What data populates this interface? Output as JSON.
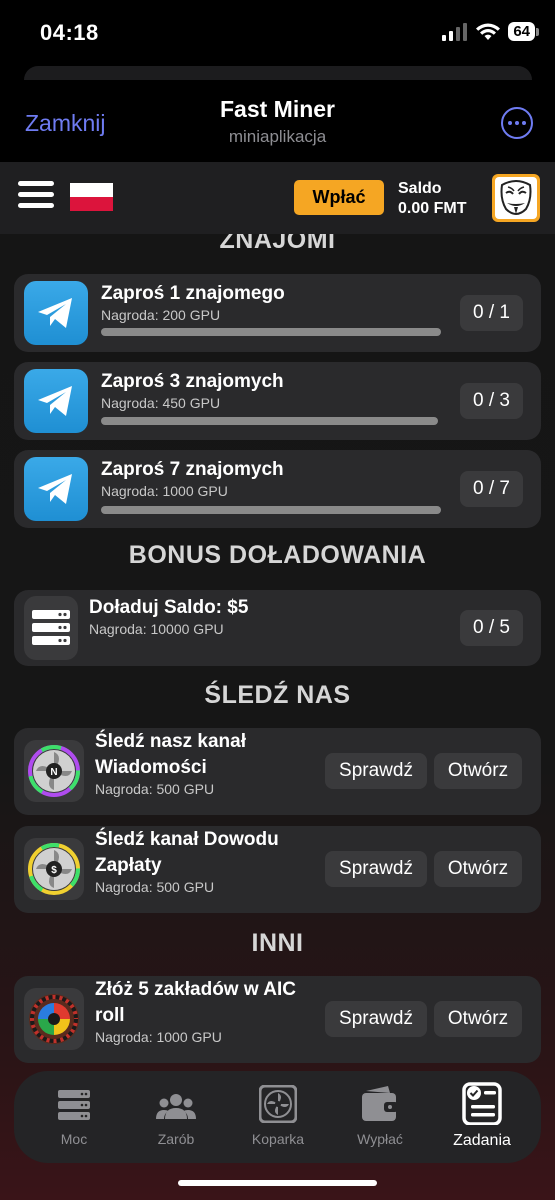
{
  "status_bar": {
    "time": "04:18",
    "battery": "64"
  },
  "header": {
    "close_label": "Zamknij",
    "title": "Fast Miner",
    "subtitle": "miniaplikacja"
  },
  "app_bar": {
    "deposit_label": "Wpłać",
    "balance_label": "Saldo",
    "balance_value": "0.00 FMT",
    "flag_colors": [
      "#ffffff",
      "#dc143c"
    ],
    "accent": "#f5a623"
  },
  "sections": {
    "friends": "ZNAJOMI",
    "bonus": "BONUS DOŁADOWANIA",
    "follow": "ŚLEDŹ NAS",
    "other": "INNI"
  },
  "friend_tasks": [
    {
      "title": "Zaproś 1 znajomego",
      "reward": "Nagroda: 200 GPU",
      "counter": "0 / 1",
      "icon": "telegram-icon",
      "progress": 0
    },
    {
      "title": "Zaproś 3 znajomych",
      "reward": "Nagroda: 450 GPU",
      "counter": "0 / 3",
      "icon": "telegram-icon",
      "progress": 0
    },
    {
      "title": "Zaproś 7 znajomych",
      "reward": "Nagroda: 1000 GPU",
      "counter": "0 / 7",
      "icon": "telegram-icon",
      "progress": 0
    }
  ],
  "bonus_task": {
    "title": "Doładuj Saldo: $5",
    "reward": "Nagroda: 10000 GPU",
    "counter": "0 / 5",
    "icon": "server-icon"
  },
  "follow_tasks": [
    {
      "title_line1": "Śledź nasz kanał",
      "title_line2": "Wiadomości",
      "reward": "Nagroda: 500 GPU",
      "check_label": "Sprawdź",
      "open_label": "Otwórz",
      "icon": "fan-n-icon",
      "badge": "N"
    },
    {
      "title_line1": "Śledź kanał Dowodu",
      "title_line2": "Zapłaty",
      "reward": "Nagroda: 500 GPU",
      "check_label": "Sprawdź",
      "open_label": "Otwórz",
      "icon": "fan-dollar-icon",
      "badge": "$"
    }
  ],
  "other_task": {
    "title_line1": "Złóż 5 zakładów w AIC",
    "title_line2": "roll",
    "reward": "Nagroda: 1000 GPU",
    "check_label": "Sprawdź",
    "open_label": "Otwórz",
    "icon": "roulette-icon"
  },
  "bottom_nav": [
    {
      "label": "Moc",
      "icon": "server-icon",
      "active": false
    },
    {
      "label": "Zarób",
      "icon": "users-icon",
      "active": false
    },
    {
      "label": "Koparka",
      "icon": "fan-icon",
      "active": false
    },
    {
      "label": "Wypłać",
      "icon": "wallet-icon",
      "active": false
    },
    {
      "label": "Zadania",
      "icon": "tasks-icon",
      "active": true
    }
  ]
}
